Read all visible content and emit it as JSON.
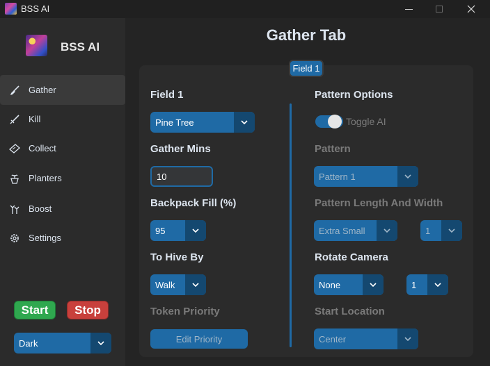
{
  "window": {
    "title": "BSS AI"
  },
  "sidebar": {
    "app_name": "BSS AI",
    "items": [
      {
        "label": "Gather",
        "icon": "shovel-icon",
        "active": true
      },
      {
        "label": "Kill",
        "icon": "sword-icon",
        "active": false
      },
      {
        "label": "Collect",
        "icon": "ticket-icon",
        "active": false
      },
      {
        "label": "Planters",
        "icon": "planter-icon",
        "active": false
      },
      {
        "label": "Boost",
        "icon": "boost-icon",
        "active": false
      },
      {
        "label": "Settings",
        "icon": "gear-icon",
        "active": false
      }
    ],
    "start_label": "Start",
    "stop_label": "Stop",
    "theme_select": "Dark"
  },
  "main": {
    "title": "Gather Tab",
    "field_tab": "Field 1",
    "left": {
      "field_label": "Field 1",
      "field_select": "Pine Tree",
      "gather_mins_label": "Gather Mins",
      "gather_mins_value": "10",
      "backpack_label": "Backpack Fill (%)",
      "backpack_select": "95",
      "to_hive_label": "To Hive By",
      "to_hive_select": "Walk",
      "token_priority_label": "Token Priority",
      "edit_priority_label": "Edit Priority"
    },
    "right": {
      "pattern_options_label": "Pattern Options",
      "toggle_ai_label": "Toggle AI",
      "toggle_ai_on": true,
      "pattern_label": "Pattern",
      "pattern_select": "Pattern 1",
      "pattern_size_label": "Pattern Length And Width",
      "pattern_length_select": "Extra Small",
      "pattern_width_select": "1",
      "rotate_camera_label": "Rotate Camera",
      "rotate_direction_select": "None",
      "rotate_count_select": "1",
      "start_location_label": "Start Location",
      "start_location_select": "Center"
    }
  },
  "colors": {
    "accent": "#1f6aa5",
    "accent_dark": "#144870",
    "start": "#2fa84f",
    "stop": "#c8403c",
    "background": "#242424",
    "panel": "#2b2b2b"
  }
}
